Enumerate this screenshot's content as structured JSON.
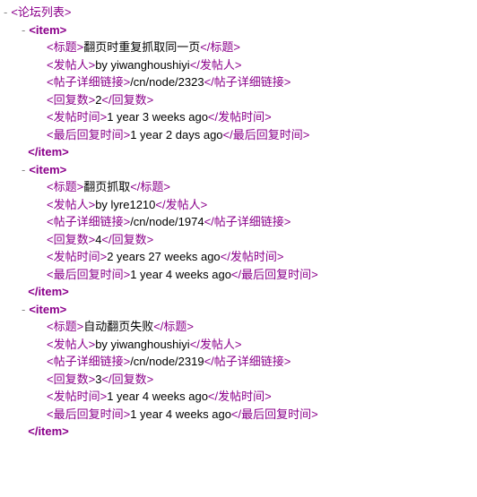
{
  "root_tag": "论坛列表",
  "item_tag": "item",
  "fields": {
    "title": "标题",
    "poster": "发帖人",
    "link": "帖子详细链接",
    "replies": "回复数",
    "posted": "发帖时间",
    "last_reply": "最后回复时间"
  },
  "items": [
    {
      "title": "翻页时重复抓取同一页",
      "poster": "by yiwanghoushiyi",
      "link": "/cn/node/2323",
      "replies": "2",
      "posted": "1 year 3 weeks ago",
      "last_reply": "1 year 2 days ago"
    },
    {
      "title": "翻页抓取",
      "poster": "by lyre1210",
      "link": "/cn/node/1974",
      "replies": "4",
      "posted": "2 years 27 weeks ago",
      "last_reply": "1 year 4 weeks ago"
    },
    {
      "title": "自动翻页失败",
      "poster": "by yiwanghoushiyi",
      "link": "/cn/node/2319",
      "replies": "3",
      "posted": "1 year 4 weeks ago",
      "last_reply": "1 year 4 weeks ago"
    }
  ]
}
